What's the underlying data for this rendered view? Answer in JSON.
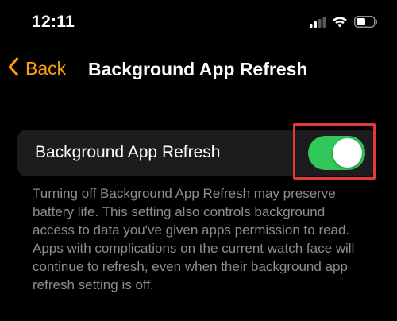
{
  "status_bar": {
    "time": "12:11",
    "icons": [
      "cellular-signal-icon",
      "wifi-icon",
      "battery-icon"
    ]
  },
  "nav": {
    "back_label": "Back",
    "title": "Background App Refresh",
    "accent_color": "#ff9f0a"
  },
  "setting": {
    "label": "Background App Refresh",
    "toggle_on": true,
    "toggle_color": "#32c759"
  },
  "footer": "Turning off Background App Refresh may preserve battery life. This setting also controls background access to data you've given apps permission to read. Apps with complications on the current watch face will continue to refresh, even when their background app refresh setting is off.",
  "highlight_color": "#e53935"
}
